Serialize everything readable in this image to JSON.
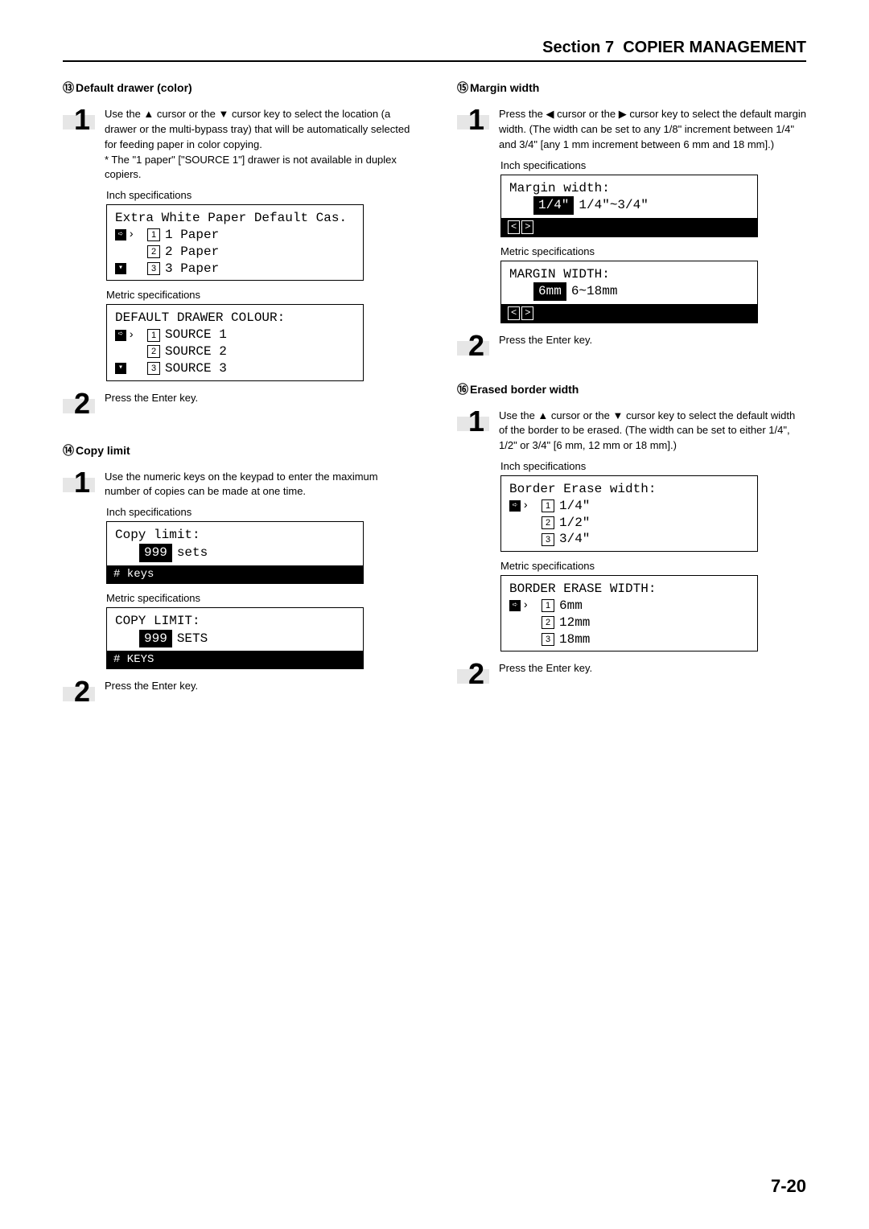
{
  "header": {
    "section": "Section 7",
    "title": "COPIER MANAGEMENT"
  },
  "page_number": "7-20",
  "left": {
    "s13": {
      "num": "⑬",
      "title": "Default drawer (color)",
      "step1_num": "1",
      "step1_text": "Use the ▲ cursor or the ▼ cursor key to select the location (a drawer or the multi-bypass tray) that will be automatically selected for feeding paper in color copying.",
      "step1_note": "* The \"1 paper\" [\"SOURCE 1\"] drawer is not available in duplex copiers.",
      "inch_label": "Inch specifications",
      "inch_lcd": {
        "title": "Extra White Paper Default Cas.",
        "opt1": "1 Paper",
        "opt2": "2 Paper",
        "opt3": "3 Paper"
      },
      "metric_label": "Metric specifications",
      "metric_lcd": {
        "title": "DEFAULT DRAWER COLOUR:",
        "opt1": "SOURCE 1",
        "opt2": "SOURCE 2",
        "opt3": "SOURCE 3"
      },
      "step2_num": "2",
      "step2_text": "Press the Enter key."
    },
    "s14": {
      "num": "⑭",
      "title": "Copy limit",
      "step1_num": "1",
      "step1_text": "Use the numeric keys on the keypad to enter the maximum number of copies can be made at one time.",
      "inch_label": "Inch specifications",
      "inch_lcd": {
        "title": "Copy limit:",
        "value": "999",
        "unit": "sets",
        "footer": "# keys"
      },
      "metric_label": "Metric specifications",
      "metric_lcd": {
        "title": "COPY LIMIT:",
        "value": "999",
        "unit": "SETS",
        "footer": "# KEYS"
      },
      "step2_num": "2",
      "step2_text": "Press the Enter key."
    }
  },
  "right": {
    "s15": {
      "num": "⑮",
      "title": "Margin width",
      "step1_num": "1",
      "step1_text": "Press the ◀ cursor or the ▶ cursor key to select the default margin width. (The width can be set to any 1/8\" increment between 1/4\" and 3/4\" [any 1 mm increment between 6 mm and 18 mm].)",
      "inch_label": "Inch specifications",
      "inch_lcd": {
        "title": "Margin width:",
        "value": "1/4\"",
        "range": "1/4\"~3/4\""
      },
      "metric_label": "Metric specifications",
      "metric_lcd": {
        "title": "MARGIN WIDTH:",
        "value": "6mm",
        "range": "6~18mm"
      },
      "step2_num": "2",
      "step2_text": "Press the Enter key."
    },
    "s16": {
      "num": "⑯",
      "title": "Erased border width",
      "step1_num": "1",
      "step1_text": "Use the ▲ cursor or the ▼ cursor key to select the default width of the border to be erased. (The width can be set to either 1/4\", 1/2\" or 3/4\" [6 mm, 12 mm or 18 mm].)",
      "inch_label": "Inch specifications",
      "inch_lcd": {
        "title": "Border Erase width:",
        "opt1": "1/4\"",
        "opt2": "1/2\"",
        "opt3": "3/4\""
      },
      "metric_label": "Metric specifications",
      "metric_lcd": {
        "title": "BORDER ERASE WIDTH:",
        "opt1": "6mm",
        "opt2": "12mm",
        "opt3": "18mm"
      },
      "step2_num": "2",
      "step2_text": "Press the Enter key."
    }
  }
}
